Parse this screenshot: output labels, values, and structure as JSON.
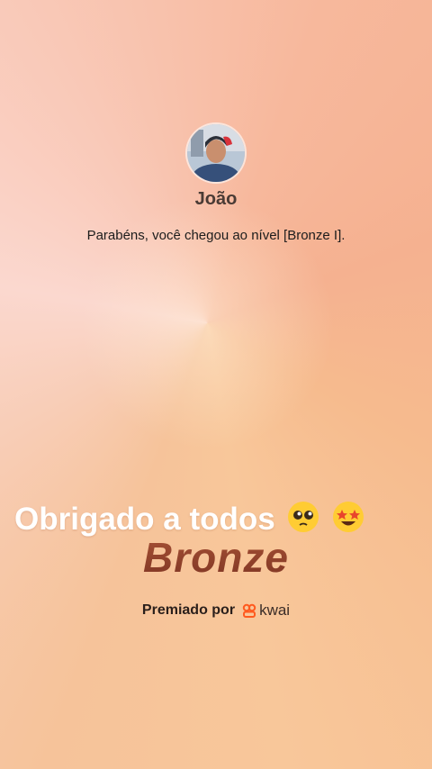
{
  "profile": {
    "name": "João",
    "avatar_icon": "user-avatar"
  },
  "message": "Parabéns, você chegou ao nível [Bronze I].",
  "overlay_text": "Obrigado a todos",
  "emojis": [
    "pleading-face",
    "star-struck"
  ],
  "level": "Bronze",
  "awarded_by": {
    "label": "Premiado por",
    "brand": "kwai",
    "brand_color": "#ff5a1f"
  },
  "colors": {
    "level": "#a85236",
    "overlay": "#ffffff"
  }
}
